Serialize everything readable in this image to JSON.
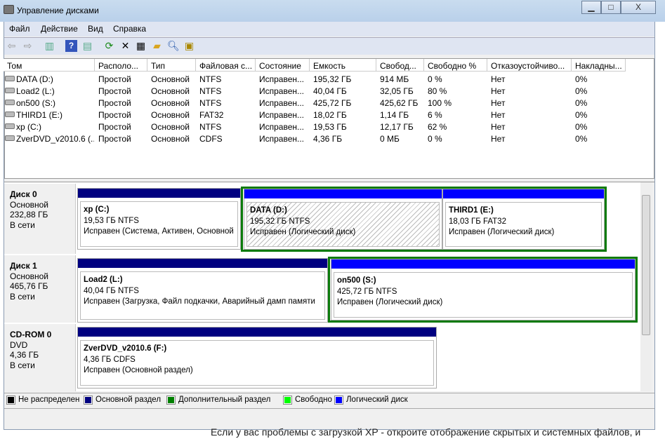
{
  "window": {
    "title": "Управление дисками",
    "minimize": "▁",
    "maximize": "□",
    "close": "X"
  },
  "menu": [
    "Файл",
    "Действие",
    "Вид",
    "Справка"
  ],
  "toolbar": [
    "back-icon",
    "forward-icon",
    "console-tree-icon",
    "help-icon",
    "action-pane-icon",
    "refresh-icon",
    "delete-icon",
    "properties-icon",
    "open-icon",
    "explore-icon",
    "settings-icon"
  ],
  "columns": [
    "Том",
    "Располо...",
    "Тип",
    "Файловая с...",
    "Состояние",
    "Емкость",
    "Свобод...",
    "Свободно %",
    "Отказоустойчиво...",
    "Накладны..."
  ],
  "rows": [
    [
      "DATA (D:)",
      "Простой",
      "Основной",
      "NTFS",
      "Исправен...",
      "195,32 ГБ",
      "914 МБ",
      "0 %",
      "Нет",
      "0%"
    ],
    [
      "Load2 (L:)",
      "Простой",
      "Основной",
      "NTFS",
      "Исправен...",
      "40,04 ГБ",
      "32,05 ГБ",
      "80 %",
      "Нет",
      "0%"
    ],
    [
      "on500 (S:)",
      "Простой",
      "Основной",
      "NTFS",
      "Исправен...",
      "425,72 ГБ",
      "425,62 ГБ",
      "100 %",
      "Нет",
      "0%"
    ],
    [
      "THIRD1 (E:)",
      "Простой",
      "Основной",
      "FAT32",
      "Исправен...",
      "18,02 ГБ",
      "1,14 ГБ",
      "6 %",
      "Нет",
      "0%"
    ],
    [
      "xp (C:)",
      "Простой",
      "Основной",
      "NTFS",
      "Исправен...",
      "19,53 ГБ",
      "12,17 ГБ",
      "62 %",
      "Нет",
      "0%"
    ],
    [
      "ZverDVD_v2010.6 (...",
      "Простой",
      "Основной",
      "CDFS",
      "Исправен...",
      "4,36 ГБ",
      "0 МБ",
      "0 %",
      "Нет",
      "0%"
    ]
  ],
  "disks": [
    {
      "name": "Диск 0",
      "type": "Основной",
      "size": "232,88 ГБ",
      "status": "В сети"
    },
    {
      "name": "Диск 1",
      "type": "Основной",
      "size": "465,76 ГБ",
      "status": "В сети"
    },
    {
      "name": "CD-ROM 0",
      "type": "DVD",
      "size": "4,36 ГБ",
      "status": "В сети"
    }
  ],
  "partitions": {
    "xp": {
      "name": "xp  (C:)",
      "size": "19,53 ГБ NTFS",
      "status": "Исправен (Система, Активен, Основной"
    },
    "data": {
      "name": "DATA  (D:)",
      "size": "195,32 ГБ NTFS",
      "status": "Исправен (Логический диск)"
    },
    "third": {
      "name": "THIRD1  (E:)",
      "size": "18,03 ГБ FAT32",
      "status": "Исправен (Логический диск)"
    },
    "load2": {
      "name": "Load2  (L:)",
      "size": "40,04 ГБ NTFS",
      "status": "Исправен (Загрузка, Файл подкачки, Аварийный дамп памяти"
    },
    "on500": {
      "name": "on500  (S:)",
      "size": "425,72 ГБ NTFS",
      "status": "Исправен (Логический диск)"
    },
    "cd": {
      "name": "ZverDVD_v2010.6  (F:)",
      "size": "4,36 ГБ CDFS",
      "status": "Исправен (Основной раздел)"
    }
  },
  "legend": [
    {
      "label": "Не распределен",
      "color": "#000000"
    },
    {
      "label": "Основной раздел",
      "color": "#000080"
    },
    {
      "label": "Дополнительный раздел",
      "color": "#008000"
    },
    {
      "label": "Свободно",
      "color": "#00ff00"
    },
    {
      "label": "Логический диск",
      "color": "#0000ff"
    }
  ],
  "page_text": "Если у вас проблемы с загрузкой XP - откроите отображение скрытых и системных файлов, и"
}
